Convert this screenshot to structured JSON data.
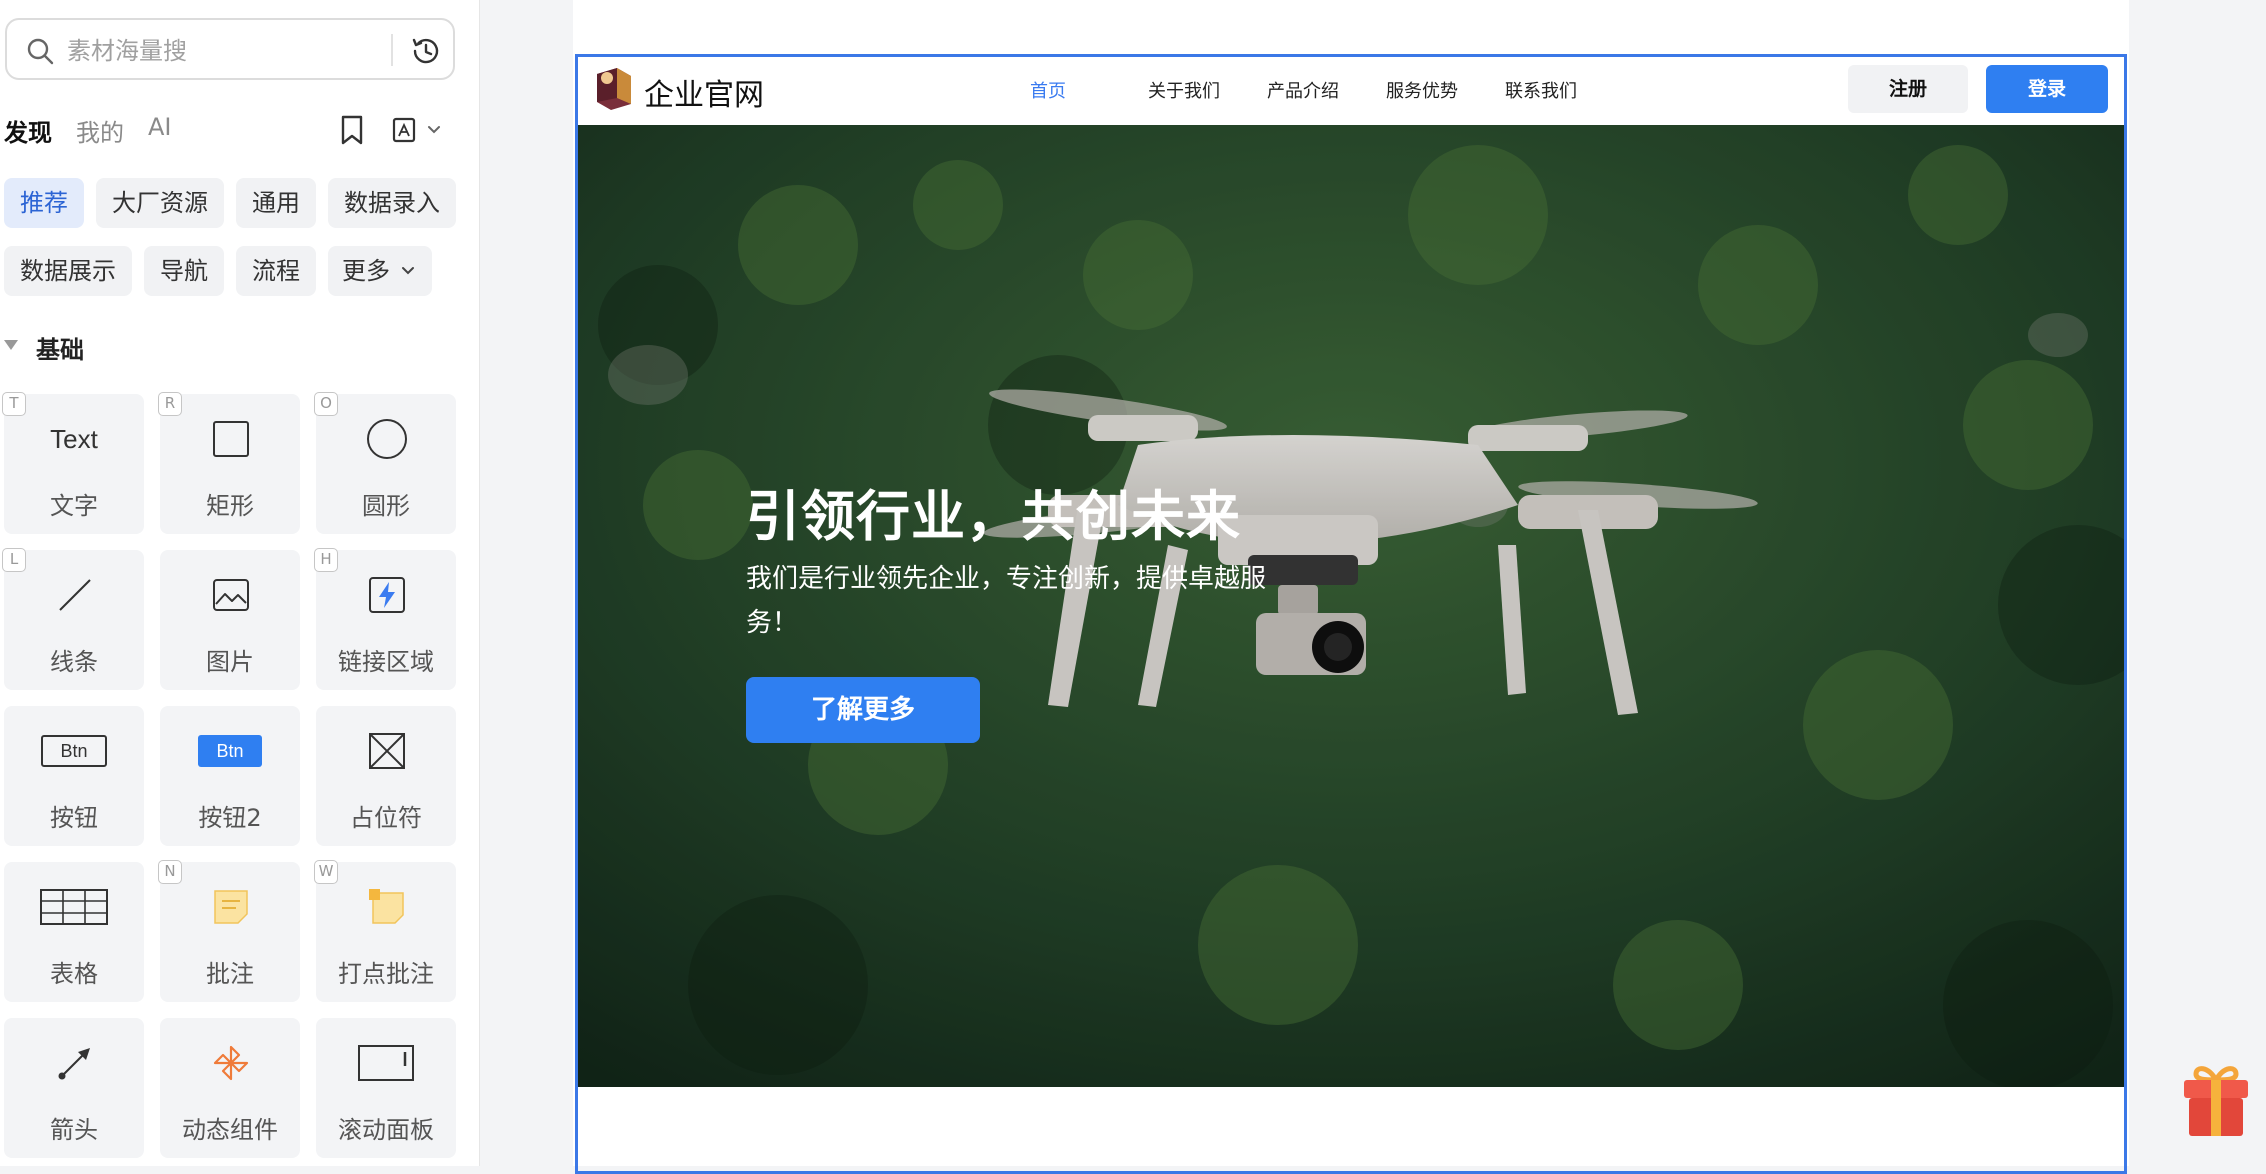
{
  "search": {
    "placeholder": "素材海量搜"
  },
  "main_tabs": {
    "discover": "发现",
    "mine": "我的",
    "ai": "AI"
  },
  "chips": {
    "recommend": "推荐",
    "big_resources": "大厂资源",
    "general": "通用",
    "data_entry": "数据录入",
    "data_display": "数据展示",
    "navigation": "导航",
    "flow": "流程",
    "more": "更多"
  },
  "section": {
    "title": "基础"
  },
  "components": [
    {
      "label": "文字",
      "shortcut": "T",
      "glyph": "Text"
    },
    {
      "label": "矩形",
      "shortcut": "R"
    },
    {
      "label": "圆形",
      "shortcut": "O"
    },
    {
      "label": "线条",
      "shortcut": "L"
    },
    {
      "label": "图片",
      "shortcut": ""
    },
    {
      "label": "链接区域",
      "shortcut": "H"
    },
    {
      "label": "按钮",
      "shortcut": "",
      "glyph": "Btn"
    },
    {
      "label": "按钮2",
      "shortcut": "",
      "glyph": "Btn"
    },
    {
      "label": "占位符",
      "shortcut": ""
    },
    {
      "label": "表格",
      "shortcut": ""
    },
    {
      "label": "批注",
      "shortcut": "N"
    },
    {
      "label": "打点批注",
      "shortcut": "W"
    },
    {
      "label": "箭头",
      "shortcut": ""
    },
    {
      "label": "动态组件",
      "shortcut": ""
    },
    {
      "label": "滚动面板",
      "shortcut": ""
    }
  ],
  "site": {
    "logo_text": "企业官网",
    "nav": [
      "首页",
      "关于我们",
      "产品介绍",
      "服务优势",
      "联系我们"
    ],
    "register": "注册",
    "login": "登录",
    "hero_title": "引领行业，共创未来",
    "hero_subtitle": "我们是行业领先企业，专注创新，提供卓越服务！",
    "hero_button": "了解更多"
  },
  "colors": {
    "accent": "#2f7ff1",
    "selection": "#3b78e7",
    "chip_active_bg": "#e3ebfb"
  }
}
